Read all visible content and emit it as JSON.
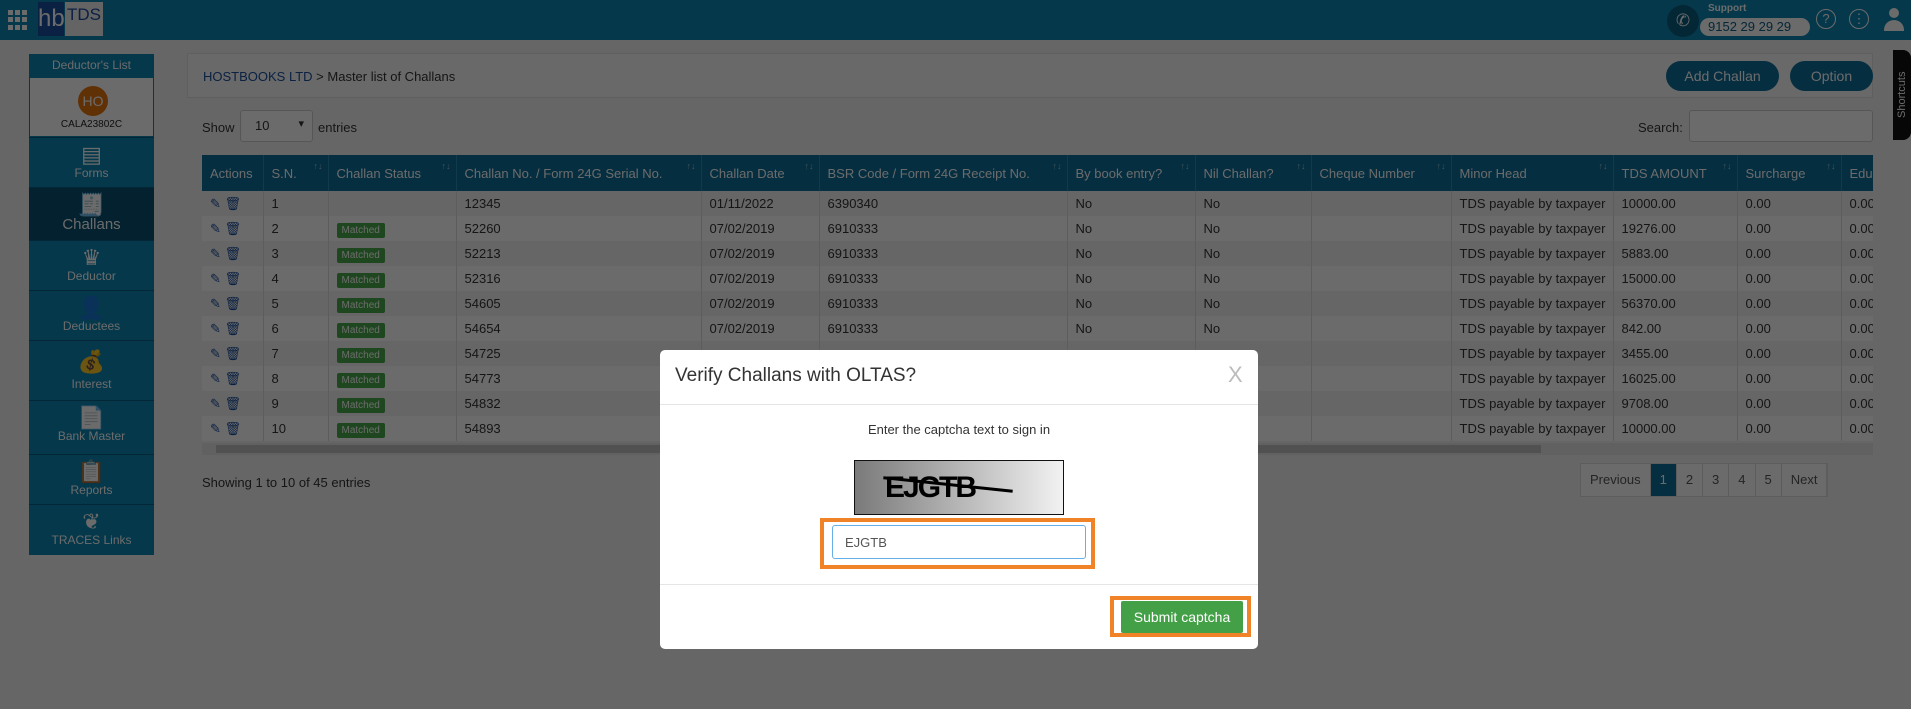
{
  "header": {
    "logo_hb": "hb",
    "logo_tds": "TDS",
    "support_label": "Support",
    "support_number": "9152 29 29 29",
    "help_icon": "?",
    "more_icon": "⋮"
  },
  "sidebar": {
    "title": "Deductor's List",
    "avatar": "HO",
    "pan": "CALA23802C",
    "items": [
      {
        "label": "Forms",
        "icon": "▤"
      },
      {
        "label": "Challans",
        "icon": "🧾"
      },
      {
        "label": "Deductor",
        "icon": "♛"
      },
      {
        "label": "Deductees",
        "icon": "👤"
      },
      {
        "label": "Interest",
        "icon": "💰"
      },
      {
        "label": "Bank Master",
        "icon": "📄"
      },
      {
        "label": "Reports",
        "icon": "📋"
      },
      {
        "label": "TRACES Links",
        "icon": "❦"
      }
    ]
  },
  "breadcrumb": {
    "company": "HOSTBOOKS LTD",
    "sep": " > ",
    "page": "Master list of Challans"
  },
  "buttons": {
    "add_challan": "Add Challan",
    "option": "Option"
  },
  "shortcuts": "Shortcuts",
  "table_controls": {
    "show": "Show",
    "page_size": "10",
    "entries": "entries",
    "search_label": "Search:",
    "search_value": ""
  },
  "table": {
    "columns": [
      "Actions",
      "S.N.",
      "Challan Status",
      "Challan No. / Form 24G Serial No.",
      "Challan Date",
      "BSR Code / Form 24G Receipt No.",
      "By book entry?",
      "Nil Challan?",
      "Cheque Number",
      "Minor Head",
      "TDS AMOUNT",
      "Surcharge",
      "Edu"
    ],
    "rows": [
      [
        "1",
        "",
        "12345",
        "01/11/2022",
        "6390340",
        "No",
        "No",
        "",
        "TDS payable by taxpayer",
        "10000.00",
        "0.00",
        "0.00"
      ],
      [
        "2",
        "Matched",
        "52260",
        "07/02/2019",
        "6910333",
        "No",
        "No",
        "",
        "TDS payable by taxpayer",
        "19276.00",
        "0.00",
        "0.00"
      ],
      [
        "3",
        "Matched",
        "52213",
        "07/02/2019",
        "6910333",
        "No",
        "No",
        "",
        "TDS payable by taxpayer",
        "5883.00",
        "0.00",
        "0.00"
      ],
      [
        "4",
        "Matched",
        "52316",
        "07/02/2019",
        "6910333",
        "No",
        "No",
        "",
        "TDS payable by taxpayer",
        "15000.00",
        "0.00",
        "0.00"
      ],
      [
        "5",
        "Matched",
        "54605",
        "07/02/2019",
        "6910333",
        "No",
        "No",
        "",
        "TDS payable by taxpayer",
        "56370.00",
        "0.00",
        "0.00"
      ],
      [
        "6",
        "Matched",
        "54654",
        "07/02/2019",
        "6910333",
        "No",
        "No",
        "",
        "TDS payable by taxpayer",
        "842.00",
        "0.00",
        "0.00"
      ],
      [
        "7",
        "Matched",
        "54725",
        "",
        "",
        "",
        "",
        "",
        "TDS payable by taxpayer",
        "3455.00",
        "0.00",
        "0.00"
      ],
      [
        "8",
        "Matched",
        "54773",
        "",
        "",
        "",
        "",
        "",
        "TDS payable by taxpayer",
        "16025.00",
        "0.00",
        "0.00"
      ],
      [
        "9",
        "Matched",
        "54832",
        "",
        "",
        "",
        "",
        "",
        "TDS payable by taxpayer",
        "9708.00",
        "0.00",
        "0.00"
      ],
      [
        "10",
        "Matched",
        "54893",
        "",
        "",
        "",
        "",
        "",
        "TDS payable by taxpayer",
        "10000.00",
        "0.00",
        "0.00"
      ]
    ]
  },
  "footer": {
    "showing": "Showing 1 to 10 of 45 entries",
    "pages": [
      "Previous",
      "1",
      "2",
      "3",
      "4",
      "5",
      "Next"
    ],
    "current_page": "1"
  },
  "modal": {
    "title": "Verify Challans with OLTAS?",
    "close": "X",
    "prompt": "Enter the captcha text to sign in",
    "captcha_image_text": "EJGTB",
    "captcha_value": "EJGTB",
    "submit": "Submit captcha"
  },
  "colors": {
    "brand": "#0b86b3",
    "highlight": "#f08228",
    "submit": "#43a047",
    "matched": "#4aa84a"
  }
}
